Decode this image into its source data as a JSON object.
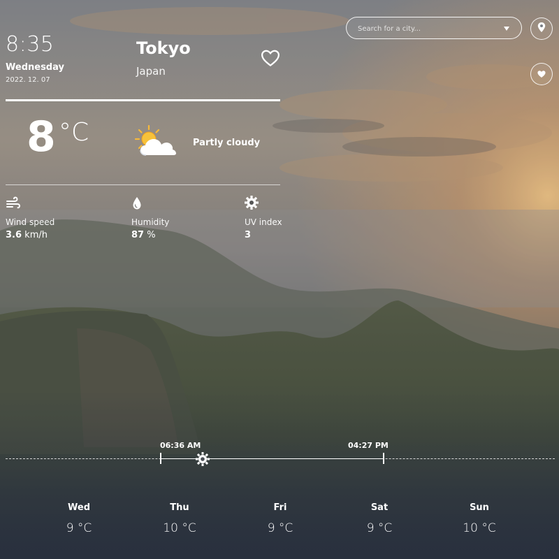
{
  "location": {
    "city": "Tokyo",
    "country": "Japan"
  },
  "clock": {
    "time": "8:35",
    "weekday": "Wednesday",
    "date": "2022. 12. 07"
  },
  "current": {
    "temperature": "8",
    "unit": "°C",
    "condition": "Partly cloudy",
    "icon": "partly-cloudy-icon"
  },
  "stats": [
    {
      "icon": "wind-icon",
      "label": "Wind speed",
      "value": "3.6",
      "unit": "km/h"
    },
    {
      "icon": "humidity-drop-icon",
      "label": "Humidity",
      "value": "87",
      "unit": "%"
    },
    {
      "icon": "sun-uv-icon",
      "label": "UV index",
      "value": "3",
      "unit": ""
    }
  ],
  "search": {
    "placeholder": "Search for a city..."
  },
  "sun": {
    "sunrise": "06:36 AM",
    "sunset": "04:27 PM",
    "day_progress": 0.16
  },
  "forecast": [
    {
      "day": "Wed",
      "temp": "9 °C"
    },
    {
      "day": "Thu",
      "temp": "10 °C"
    },
    {
      "day": "Fri",
      "temp": "9 °C"
    },
    {
      "day": "Sat",
      "temp": "9 °C"
    },
    {
      "day": "Sun",
      "temp": "10 °C"
    }
  ],
  "colors": {
    "text": "#ffffff",
    "sky_glow": "#f5b86a",
    "valley": "#3f4a3a"
  }
}
